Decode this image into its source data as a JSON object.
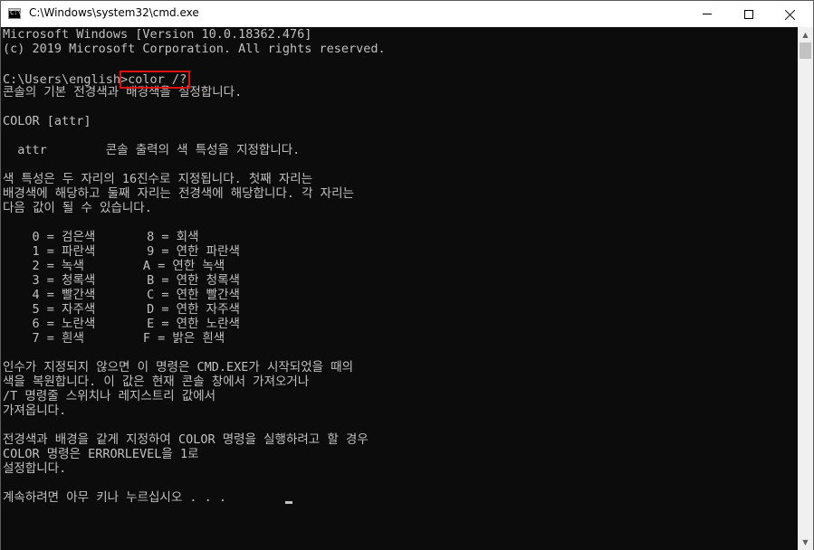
{
  "window": {
    "title": "C:\\Windows\\system32\\cmd.exe",
    "icon": "cmd-icon",
    "icon_text": "C:\\"
  },
  "controls": {
    "minimize_icon": "minimize-icon",
    "maximize_icon": "maximize-icon",
    "close_icon": "close-icon"
  },
  "console": {
    "lines": [
      "Microsoft Windows [Version 10.0.18362.476]",
      "(c) 2019 Microsoft Corporation. All rights reserved.",
      "",
      "C:\\Users\\english>color /?",
      "콘솔의 기본 전경색과 배경색을 설정합니다.",
      "",
      "COLOR [attr]",
      "",
      "  attr        콘솔 출력의 색 특성을 지정합니다.",
      "",
      "색 특성은 두 자리의 16진수로 지정됩니다. 첫째 자리는",
      "배경색에 해당하고 둘째 자리는 전경색에 해당합니다. 각 자리는",
      "다음 값이 될 수 있습니다.",
      "",
      "    0 = 검은색       8 = 회색",
      "    1 = 파란색       9 = 연한 파란색",
      "    2 = 녹색        A = 연한 녹색",
      "    3 = 청록색       B = 연한 청록색",
      "    4 = 빨간색       C = 연한 빨간색",
      "    5 = 자주색       D = 연한 자주색",
      "    6 = 노란색       E = 연한 노란색",
      "    7 = 흰색        F = 밝은 흰색",
      "",
      "인수가 지정되지 않으면 이 명령은 CMD.EXE가 시작되었을 때의",
      "색을 복원합니다. 이 값은 현재 콘솔 창에서 가져오거나",
      "/T 명령줄 스위치나 레지스트리 값에서",
      "가져옵니다.",
      "",
      "전경색과 배경을 같게 지정하여 COLOR 명령을 실행하려고 할 경우",
      "COLOR 명령은 ERRORLEVEL을 1로",
      "설정합니다.",
      "",
      "계속하려면 아무 키나 누르십시오 . . ."
    ]
  },
  "colors": {
    "console_bg": "#0c0c0c",
    "console_text": "#c0c0c0",
    "highlight_box": "#e01010"
  }
}
